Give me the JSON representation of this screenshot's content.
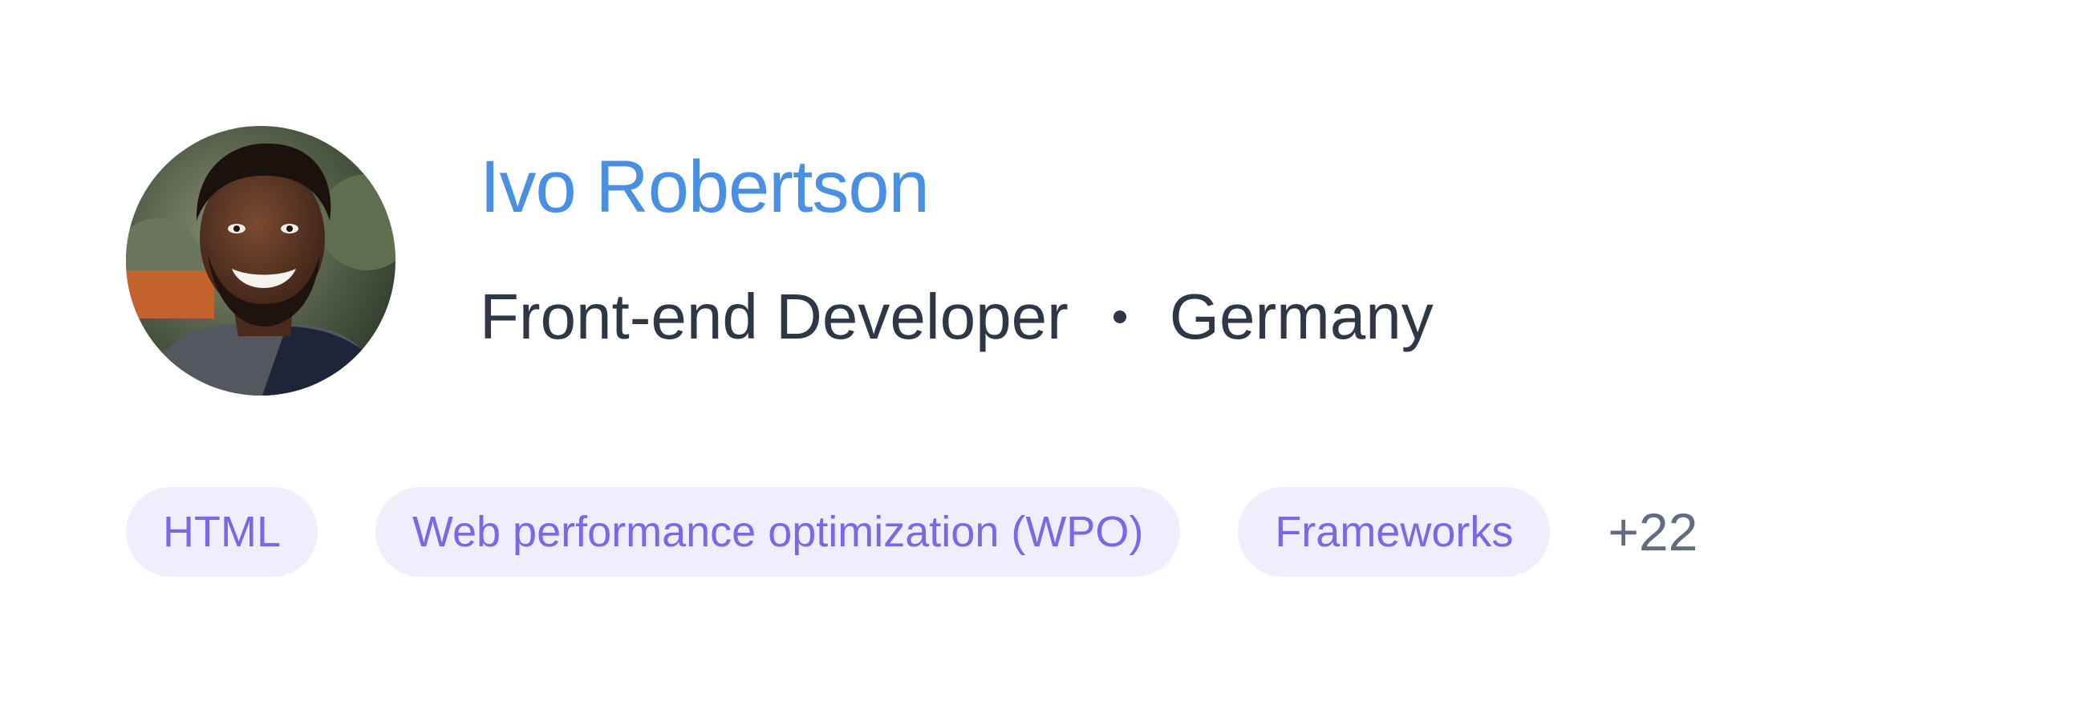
{
  "profile": {
    "name": "Ivo Robertson",
    "role": "Front-end Developer",
    "location": "Germany",
    "avatar_icon": "person-photo"
  },
  "tags": {
    "items": [
      "HTML",
      "Web performance optimization (WPO)",
      "Frameworks"
    ],
    "more_count": "+22"
  },
  "colors": {
    "name": "#4a90e2",
    "text": "#2f3747",
    "tag_bg": "#f0eefc",
    "tag_text": "#7b68e6",
    "muted": "#636b7e"
  }
}
